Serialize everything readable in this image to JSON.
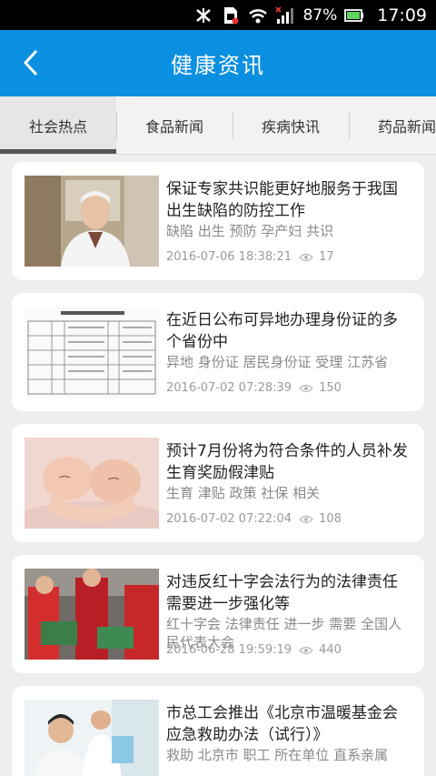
{
  "status_bar": {
    "battery_percent": "87%",
    "time": "17:09",
    "icons": [
      "bluetooth-icon",
      "sim-card-icon",
      "wifi-icon",
      "signal-icon",
      "battery-icon"
    ]
  },
  "header": {
    "title": "健康资讯",
    "back_icon": "back-chevron-icon"
  },
  "tabs": [
    {
      "label": "社会热点",
      "active": true
    },
    {
      "label": "食品新闻",
      "active": false
    },
    {
      "label": "疾病快讯",
      "active": false
    },
    {
      "label": "药品新闻",
      "active": false
    }
  ],
  "articles": [
    {
      "title": "保证专家共识能更好地服务于我国出生缺陷的防控工作",
      "tags": "缺陷 出生 预防 孕产妇 共识",
      "date": "2016-07-06 18:38:21",
      "views": "17"
    },
    {
      "title": "在近日公布可异地办理身份证的多个省份中",
      "tags": "异地 身份证 居民身份证 受理 江苏省",
      "date": "2016-07-02 07:28:39",
      "views": "150"
    },
    {
      "title": "预计7月份将为符合条件的人员补发生育奖励假津贴",
      "tags": "生育 津贴 政策 社保 相关",
      "date": "2016-07-02 07:22:04",
      "views": "108"
    },
    {
      "title": "对违反红十字会法行为的法律责任需要进一步强化等",
      "tags": "红十字会 法律责任 进一步 需要 全国人民代表大会",
      "date": "2016-06-28 19:59:19",
      "views": "440"
    },
    {
      "title": "市总工会推出《北京市温暖基金会应急救助办法（试行）》",
      "tags": "救助 北京市 职工 所在单位 直系亲属",
      "date": "",
      "views": ""
    }
  ],
  "colors": {
    "header_blue": "#0b8fe0",
    "page_bg": "#eeeeee"
  }
}
